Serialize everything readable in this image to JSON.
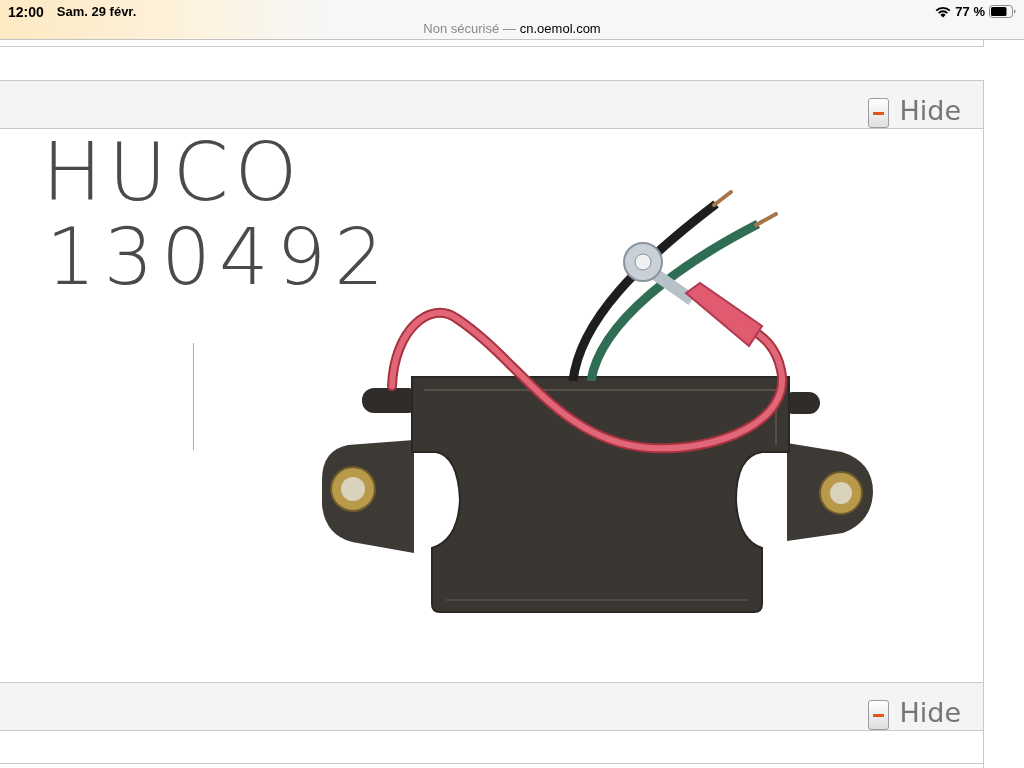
{
  "status_bar": {
    "time": "12:00",
    "date": "Sam. 29 févr.",
    "battery_text": "77 %"
  },
  "address_bar": {
    "security_label": "Non sécurisé —",
    "domain": "cn.oemol.com"
  },
  "panels": [
    {
      "toggle_label": "Hide",
      "expanded": true,
      "content": {
        "kind": "photo",
        "handwriting": [
          "HUCO",
          "130492"
        ]
      }
    },
    {
      "toggle_label": "Hide",
      "expanded": true
    }
  ]
}
